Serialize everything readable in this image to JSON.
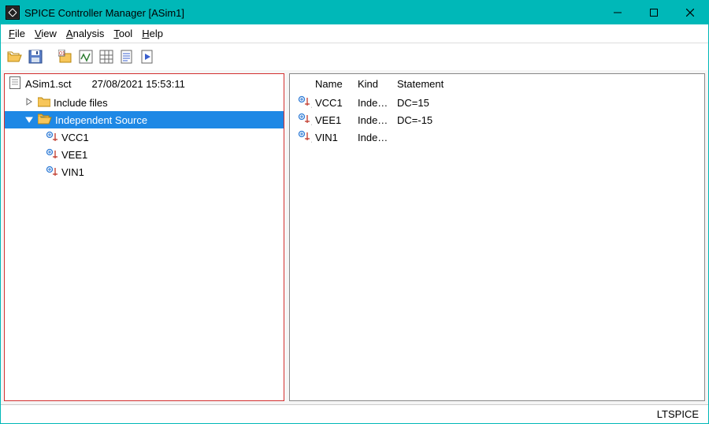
{
  "window": {
    "title": "SPICE Controller Manager [ASim1]"
  },
  "menu": {
    "file": "File",
    "view": "View",
    "analysis": "Analysis",
    "tool": "Tool",
    "help": "Help"
  },
  "tree": {
    "file_label": "ASim1.sct",
    "file_date": "27/08/2021 15:53:11",
    "include_label": "Include files",
    "indep_label": "Independent Source",
    "leaves": [
      {
        "label": "VCC1"
      },
      {
        "label": "VEE1"
      },
      {
        "label": "VIN1"
      }
    ]
  },
  "list": {
    "headers": {
      "name": "Name",
      "kind": "Kind",
      "statement": "Statement"
    },
    "rows": [
      {
        "name": "VCC1",
        "kind": "Inde…",
        "statement": "DC=15"
      },
      {
        "name": "VEE1",
        "kind": "Inde…",
        "statement": "DC=-15"
      },
      {
        "name": "VIN1",
        "kind": "Inde…",
        "statement": ""
      }
    ]
  },
  "status": {
    "text": "LTSPICE"
  }
}
